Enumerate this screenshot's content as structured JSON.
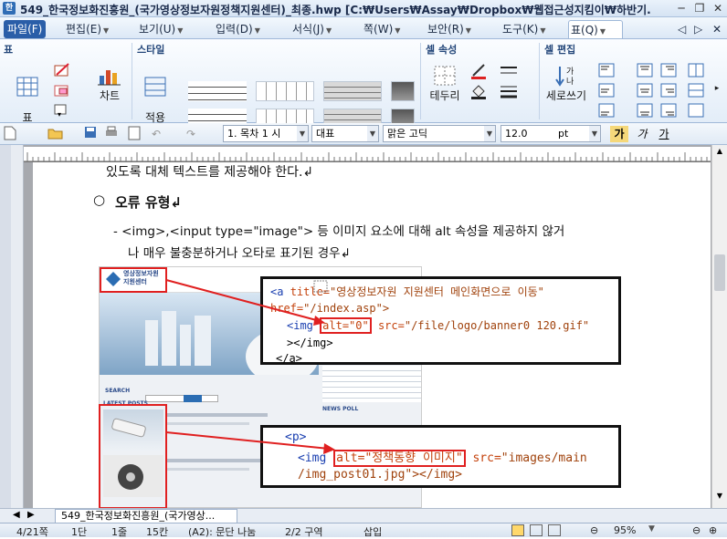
{
  "titlebar": {
    "app_icon": "hwp-app-icon",
    "title": "549_한국정보화진흥원_(국가영상정보자원정책지원센터)_최종.hwp [C:₩Users₩Assay₩Dropbox₩웹접근성지킴이₩하반기...",
    "minimize": "─",
    "restore": "❐",
    "close": "✕"
  },
  "menubar": {
    "items": [
      "파일(F)",
      "편집(E)",
      "보기(U)",
      "입력(D)",
      "서식(J)",
      "쪽(W)",
      "보안(R)",
      "도구(K)",
      "표(Q)"
    ],
    "right_icons": [
      "◁",
      "▷",
      "✕"
    ]
  },
  "ribbon": {
    "groups": [
      "표",
      "스타일",
      "셀 속성",
      "셀 편집"
    ],
    "buttons": {
      "table_make": "표\n만들기",
      "chart": "차트",
      "apply_options": "적용\n옵션",
      "border": "테두리",
      "vertical_write": "세로쓰기"
    }
  },
  "toolbar": {
    "style_combo": "1. 목차 1 시",
    "lang_combo": "대표",
    "font_combo": "맑은 고딕",
    "size_combo": "12.0",
    "size_unit": "pt",
    "bold": "가",
    "italic": "가",
    "underline": "가"
  },
  "document": {
    "top_line": "있도록 대체 텍스트를 제공해야 한다.↲",
    "heading_bullet": "○",
    "heading": "오류 유형↲",
    "item_line1": "- <img>,<input type=\"image\"> 등 이미지 요소에 대해 alt 속성을 제공하지 않거",
    "item_line2": "나 매우 불충분하거나 오타로 표기된 경우↲",
    "code1": {
      "line1_tag": "<a",
      "line1_attr": "title=",
      "line1_value": "\"영상정보자원 지원센터 메인화면으로 이동\"",
      "line2_attr": "href=",
      "line2_value": "\"/index.asp\">",
      "line3_tag": "<img",
      "line3_alt": "alt=\"0\"",
      "line3_src_attr": "src=",
      "line3_src": "\"/file/logo/banner0 120.gif\"",
      "line4": "></img>",
      "line5": "</a>"
    },
    "code2": {
      "line1": "<p>",
      "line2_tag": "<img",
      "line2_alt": "alt=\"정책동향 이미지\"",
      "line2_src_attr": "src=",
      "line2_src": "\"images/main",
      "line3": "/img_post01.jpg\"></img>"
    },
    "screenshot": {
      "logo_text": "영상정보자원\n지원센터",
      "search_label": "SEARCH",
      "latest_posts": "LATEST POSTS",
      "news_poll": "NEWS POLL"
    }
  },
  "tabbar": {
    "doc_tab": "549_한국정보화진흥원_(국가영상..."
  },
  "statusbar": {
    "page": "4/21쪽",
    "section": "1단",
    "line": "1줄",
    "column": "15칸",
    "para": "(A2): 문단 나눔",
    "zone": "2/2 구역",
    "mode": "삽입",
    "zoom": "95%"
  },
  "colors": {
    "accent": "#2a5ea8",
    "highlight_red": "#e02020"
  }
}
